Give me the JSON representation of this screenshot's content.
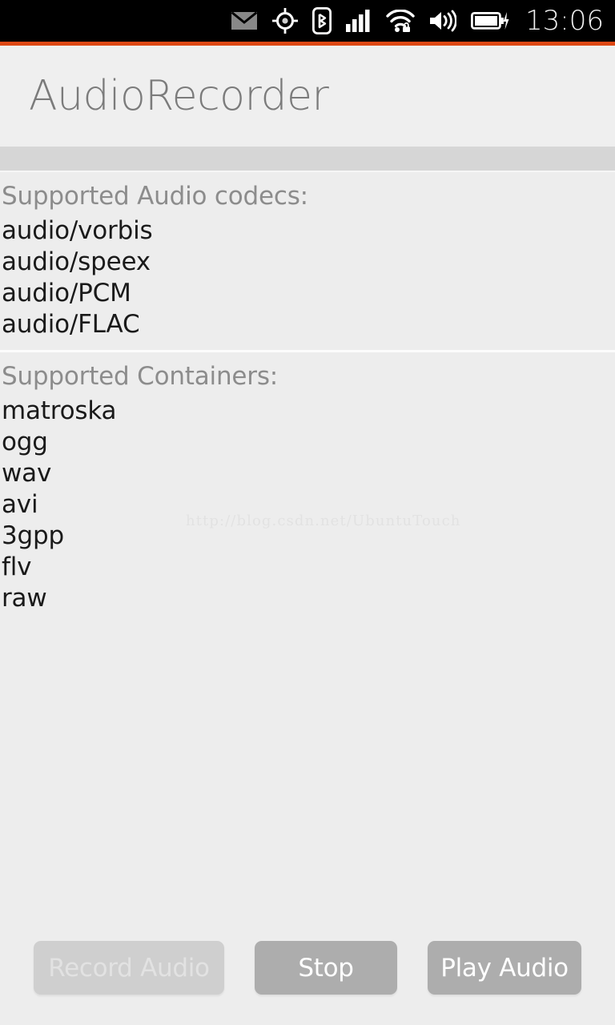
{
  "statusbar": {
    "time": "13:06",
    "icons": [
      {
        "name": "mail-icon",
        "glyph": "envelope"
      },
      {
        "name": "location-icon",
        "glyph": "gps-crosshair"
      },
      {
        "name": "bluetooth-icon",
        "glyph": "bluetooth"
      },
      {
        "name": "cellular-signal-icon",
        "glyph": "signal-bars"
      },
      {
        "name": "wifi-icon",
        "glyph": "wifi-secure"
      },
      {
        "name": "volume-icon",
        "glyph": "speaker-waves"
      },
      {
        "name": "battery-icon",
        "glyph": "battery-charging"
      }
    ],
    "background_color": "#000000",
    "accent_line_color": "#dd4814"
  },
  "header": {
    "title": "AudioRecorder",
    "title_color": "#7b7b7b",
    "background_color": "#efefef",
    "band_color": "#d6d6d6"
  },
  "sections": [
    {
      "title": "Supported Audio codecs:",
      "items": [
        "audio/vorbis",
        "audio/speex",
        "audio/PCM",
        "audio/FLAC"
      ]
    },
    {
      "title": "Supported Containers:",
      "items": [
        "matroska",
        "ogg",
        "wav",
        "avi",
        "3gpp",
        "flv",
        "raw"
      ]
    }
  ],
  "watermark": {
    "text": "http://blog.csdn.net/UbuntuTouch"
  },
  "buttons": [
    {
      "label": "Record Audio",
      "state": "disabled",
      "color": "#cfcfcf",
      "text_color": "#e2e2e2"
    },
    {
      "label": "Stop",
      "state": "enabled",
      "color": "#adadad",
      "text_color": "#ffffff"
    },
    {
      "label": "Play Audio",
      "state": "enabled",
      "color": "#adadad",
      "text_color": "#ffffff"
    }
  ],
  "page": {
    "background_color": "#ededed"
  }
}
